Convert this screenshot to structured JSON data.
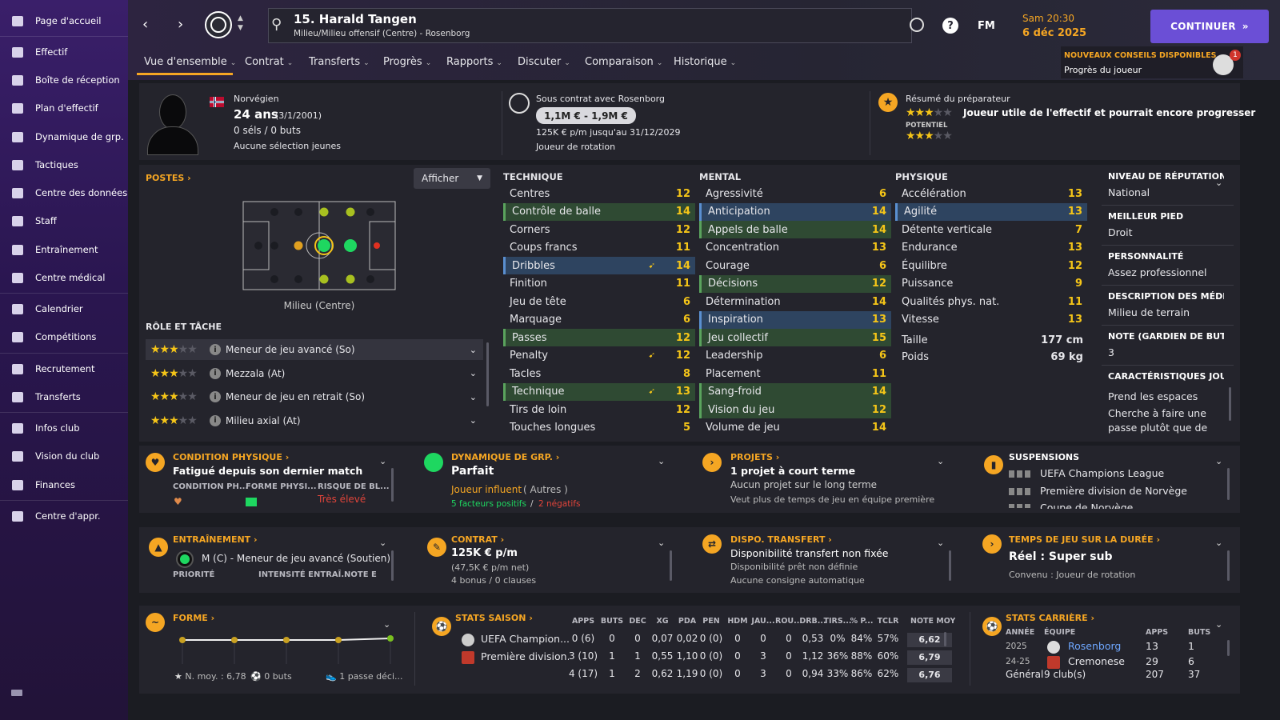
{
  "sidebar": {
    "items": [
      {
        "label": "Page d'accueil",
        "icon": "home-icon"
      },
      {
        "label": "Effectif",
        "icon": "shirt-icon"
      },
      {
        "label": "Boîte de réception",
        "icon": "inbox-icon"
      },
      {
        "label": "Plan d'effectif",
        "icon": "clipboard-icon"
      },
      {
        "label": "Dynamique de grp.",
        "icon": "people-icon"
      },
      {
        "label": "Tactiques",
        "icon": "tactics-icon"
      },
      {
        "label": "Centre des données",
        "icon": "data-icon"
      },
      {
        "label": "Staff",
        "icon": "staff-icon"
      },
      {
        "label": "Entraînement",
        "icon": "cone-icon"
      },
      {
        "label": "Centre médical",
        "icon": "medical-icon"
      },
      {
        "label": "Calendrier",
        "icon": "calendar-icon"
      },
      {
        "label": "Compétitions",
        "icon": "trophy-icon"
      },
      {
        "label": "Recrutement",
        "icon": "magnifier-icon"
      },
      {
        "label": "Transferts",
        "icon": "transfer-icon"
      },
      {
        "label": "Infos club",
        "icon": "shield-icon"
      },
      {
        "label": "Vision du club",
        "icon": "vision-icon"
      },
      {
        "label": "Finances",
        "icon": "finance-icon"
      },
      {
        "label": "Centre d'appr.",
        "icon": "learning-icon"
      }
    ]
  },
  "header": {
    "player_title": "15. Harald Tangen",
    "player_subtitle": "Milieu/Milieu offensif (Centre) - Rosenborg",
    "fm": "FM",
    "time": "Sam 20:30",
    "date": "6 déc 2025",
    "continue": "CONTINUER",
    "advice_title": "NOUVEAUX CONSEILS DISPONIBLES",
    "advice_sub": "Progrès du joueur",
    "advice_badge": "1"
  },
  "tabs": [
    "Vue d'ensemble",
    "Contrat",
    "Transferts",
    "Progrès",
    "Rapports",
    "Discuter",
    "Comparaison",
    "Historique"
  ],
  "profile": {
    "nationality": "Norvégien",
    "age": "24 ans",
    "dob": "(3/1/2001)",
    "caps": "0 séls / 0 buts",
    "youth": "Aucune sélection jeunes",
    "contract_with": "Sous contrat avec Rosenborg",
    "value": "1,1M € - 1,9M €",
    "wage": "125K € p/m jusqu'au 31/12/2029",
    "status": "Joueur de rotation",
    "coach_title": "Résumé du préparateur",
    "coach_text": "Joueur utile de l'effectif et pourrait encore progresser",
    "potential_label": "POTENTIEL"
  },
  "positions": {
    "title": "POSTES",
    "afficher": "Afficher",
    "label": "Milieu (Centre)",
    "role_title": "RÔLE ET TÂCHE",
    "roles": [
      "Meneur de jeu avancé (So)",
      "Mezzala (At)",
      "Meneur de jeu en retrait (So)",
      "Milieu axial (At)"
    ]
  },
  "attributes": {
    "technique": {
      "title": "TECHNIQUE",
      "rows": [
        [
          "Centres",
          "12"
        ],
        [
          "Contrôle de balle",
          "14"
        ],
        [
          "Corners",
          "12"
        ],
        [
          "Coups francs",
          "11"
        ],
        [
          "Dribbles",
          "14"
        ],
        [
          "Finition",
          "11"
        ],
        [
          "Jeu de tête",
          "6"
        ],
        [
          "Marquage",
          "6"
        ],
        [
          "Passes",
          "12"
        ],
        [
          "Penalty",
          "12"
        ],
        [
          "Tacles",
          "8"
        ],
        [
          "Technique",
          "13"
        ],
        [
          "Tirs de loin",
          "12"
        ],
        [
          "Touches longues",
          "5"
        ]
      ]
    },
    "mental": {
      "title": "MENTAL",
      "rows": [
        [
          "Agressivité",
          "6"
        ],
        [
          "Anticipation",
          "14"
        ],
        [
          "Appels de balle",
          "14"
        ],
        [
          "Concentration",
          "13"
        ],
        [
          "Courage",
          "6"
        ],
        [
          "Décisions",
          "12"
        ],
        [
          "Détermination",
          "14"
        ],
        [
          "Inspiration",
          "13"
        ],
        [
          "Jeu collectif",
          "15"
        ],
        [
          "Leadership",
          "6"
        ],
        [
          "Placement",
          "11"
        ],
        [
          "Sang-froid",
          "14"
        ],
        [
          "Vision du jeu",
          "12"
        ],
        [
          "Volume de jeu",
          "14"
        ]
      ]
    },
    "physique": {
      "title": "PHYSIQUE",
      "rows": [
        [
          "Accélération",
          "13"
        ],
        [
          "Agilité",
          "13"
        ],
        [
          "Détente verticale",
          "7"
        ],
        [
          "Endurance",
          "13"
        ],
        [
          "Équilibre",
          "12"
        ],
        [
          "Puissance",
          "9"
        ],
        [
          "Qualités phys. nat.",
          "11"
        ],
        [
          "Vitesse",
          "13"
        ]
      ],
      "height_label": "Taille",
      "height": "177 cm",
      "weight_label": "Poids",
      "weight": "69 kg"
    }
  },
  "info": [
    {
      "title": "NIVEAU DE RÉPUTATION",
      "value": "National"
    },
    {
      "title": "MEILLEUR PIED",
      "value": "Droit"
    },
    {
      "title": "PERSONNALITÉ",
      "value": "Assez professionnel"
    },
    {
      "title": "DESCRIPTION DES MÉDI...",
      "value": "Milieu de terrain"
    },
    {
      "title": "NOTE (GARDIEN DE BUT)",
      "value": "3"
    },
    {
      "title": "CARACTÉRISTIQUES JOUEU",
      "value": "Prend les espaces"
    }
  ],
  "info_extra": "Cherche à faire une passe plutôt que de",
  "cards": {
    "condition": {
      "title": "CONDITION PHYSIQUE",
      "main": "Fatigué depuis son dernier match",
      "c1": "CONDITION PH...",
      "c2": "FORME PHYSI...",
      "c3": "RISQUE DE BL...",
      "risk": "Très élevé"
    },
    "dynamique": {
      "title": "DYNAMIQUE DE GRP.",
      "main": "Parfait",
      "sub": "Joueur influent",
      "sub2": "( Autres )",
      "pos": "5 facteurs positifs",
      "sep": "/",
      "neg": "2 négatifs"
    },
    "projets": {
      "title": "PROJETS",
      "main": "1 projet à court terme",
      "l2": "Aucun projet sur le long terme",
      "l3": "Veut plus de temps de jeu en équipe première"
    },
    "suspensions": {
      "title": "SUSPENSIONS",
      "l1": "UEFA Champions League",
      "l2": "Première division de Norvège",
      "l3": "Coupe de Norvège"
    },
    "entrainement": {
      "title": "ENTRAÎNEMENT",
      "main": "M (C) - Meneur de jeu avancé (Soutien)",
      "c1": "PRIORITÉ",
      "c2": "INTENSITÉ ENTRAÎ...",
      "c3": "NOTE E"
    },
    "contrat": {
      "title": "CONTRAT",
      "main": "125K € p/m",
      "l2": "(47,5K € p/m net)",
      "l3": "4 bonus / 0 clauses"
    },
    "transfert": {
      "title": "DISPO. TRANSFERT",
      "main": "Disponibilité transfert non fixée",
      "l2": "Disponibilité prêt non définie",
      "l3": "Aucune consigne automatique"
    },
    "tempsjeu": {
      "title": "TEMPS DE JEU SUR LA DURÉE",
      "main": "Réel : Super sub",
      "l2": "Convenu :  Joueur de rotation"
    }
  },
  "forme": {
    "title": "FORME",
    "avg": "N. moy. : 6,78",
    "goals": "0 buts",
    "assists": "1 passe déci..."
  },
  "stats_saison": {
    "title": "STATS SAISON",
    "headers": [
      "APPS",
      "BUTS",
      "DÉC",
      "XG",
      "PDA",
      "PEN",
      "HDM",
      "JAU...",
      "ROU...",
      "DRB...",
      "TIRS...",
      "% P...",
      "TCLR",
      "NOTE MOY"
    ],
    "rows": [
      {
        "comp": "UEFA Champion...",
        "vals": [
          "0 (6)",
          "0",
          "0",
          "0,07",
          "0,02",
          "0 (0)",
          "0",
          "0",
          "0",
          "0,53",
          "0%",
          "84%",
          "57%",
          "6,62"
        ]
      },
      {
        "comp": "Première division...",
        "vals": [
          "3 (10)",
          "1",
          "1",
          "0,55",
          "1,10",
          "0 (0)",
          "0",
          "3",
          "0",
          "1,12",
          "36%",
          "88%",
          "60%",
          "6,79"
        ]
      },
      {
        "comp": "",
        "vals": [
          "4 (17)",
          "1",
          "2",
          "0,62",
          "1,19",
          "0 (0)",
          "0",
          "3",
          "0",
          "0,94",
          "33%",
          "86%",
          "62%",
          "6,76"
        ]
      }
    ]
  },
  "stats_carriere": {
    "title": "STATS CARRIÈRE",
    "h_year": "ANNÉE",
    "h_team": "ÉQUIPE",
    "h_apps": "APPS",
    "h_goals": "BUTS",
    "rows": [
      {
        "year": "2025",
        "team": "Rosenborg",
        "apps": "13",
        "goals": "1"
      },
      {
        "year": "24-25",
        "team": "Cremonese",
        "apps": "29",
        "goals": "6"
      }
    ],
    "total_label": "Général",
    "total_clubs": "9 club(s)",
    "total_apps": "207",
    "total_goals": "37"
  },
  "colors": {
    "accent": "#f5a623",
    "purple": "#6b4fd6",
    "green_hl": "#2f4a33",
    "blue_hl": "#2e4460"
  }
}
